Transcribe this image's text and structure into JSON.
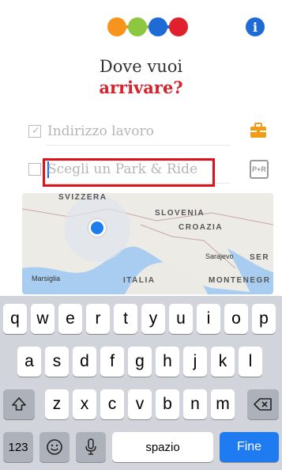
{
  "header": {
    "progress_dot_colors": [
      "#f7941d",
      "#8dc63f",
      "#1f6bd6",
      "#e0202c"
    ],
    "info_icon": "info-icon",
    "title_line1": "Dove vuoi",
    "title_line2": "arrivare?"
  },
  "form": {
    "work_address": {
      "text": "Indirizzo lavoro",
      "checked": true,
      "icon": "briefcase-icon"
    },
    "park_ride": {
      "placeholder": "Scegli un Park & Ride",
      "checked": false,
      "icon": "park-and-ride-icon",
      "icon_text": "P+R"
    }
  },
  "map": {
    "labels": [
      "SVIZZERA",
      "SLOVENIA",
      "CROAZIA",
      "ITALIA",
      "MONTENEGR",
      "SER"
    ],
    "cities": [
      "Sarajevo",
      "Marsiglia"
    ]
  },
  "keyboard": {
    "row1": [
      "q",
      "w",
      "e",
      "r",
      "t",
      "y",
      "u",
      "i",
      "o",
      "p"
    ],
    "row2": [
      "a",
      "s",
      "d",
      "f",
      "g",
      "h",
      "j",
      "k",
      "l"
    ],
    "row3": [
      "z",
      "x",
      "c",
      "v",
      "b",
      "n",
      "m"
    ],
    "shift_icon": "shift-icon",
    "backspace_icon": "backspace-icon",
    "numbers_label": "123",
    "emoji_icon": "emoji-icon",
    "mic_icon": "microphone-icon",
    "space_label": "spazio",
    "done_label": "Fine"
  }
}
